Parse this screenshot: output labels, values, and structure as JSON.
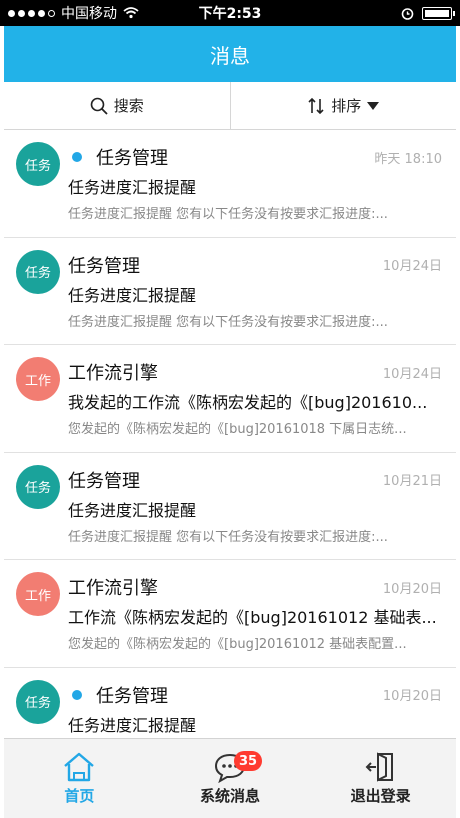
{
  "status_bar": {
    "carrier": "中国移动",
    "time": "下午2:53"
  },
  "header": {
    "title": "消息"
  },
  "toolbar": {
    "search_label": "搜索",
    "sort_label": "排序"
  },
  "colors": {
    "accent": "#22b2e8",
    "task_avatar": "#1aa39b",
    "workflow_avatar": "#f27d72",
    "badge": "#ff3b30"
  },
  "messages": [
    {
      "avatar": "任务",
      "title": "任务管理",
      "unread": true,
      "time": "昨天 18:10",
      "subject": "任务进度汇报提醒",
      "preview": "任务进度汇报提醒 您有以下任务没有按要求汇报进度:..."
    },
    {
      "avatar": "任务",
      "title": "任务管理",
      "unread": false,
      "time": "10月24日",
      "subject": "任务进度汇报提醒",
      "preview": "任务进度汇报提醒 您有以下任务没有按要求汇报进度:..."
    },
    {
      "avatar": "工作",
      "title": "工作流引擎",
      "unread": false,
      "time": "10月24日",
      "subject": "我发起的工作流《陈柄宏发起的《[bug]201610...",
      "preview": "您发起的《陈柄宏发起的《[bug]20161018 下属日志统..."
    },
    {
      "avatar": "任务",
      "title": "任务管理",
      "unread": false,
      "time": "10月21日",
      "subject": "任务进度汇报提醒",
      "preview": "任务进度汇报提醒 您有以下任务没有按要求汇报进度:..."
    },
    {
      "avatar": "工作",
      "title": "工作流引擎",
      "unread": false,
      "time": "10月20日",
      "subject": "工作流《陈柄宏发起的《[bug]20161012 基础表...",
      "preview": "您发起的《陈柄宏发起的《[bug]20161012 基础表配置..."
    },
    {
      "avatar": "任务",
      "title": "任务管理",
      "unread": true,
      "time": "10月20日",
      "subject": "任务进度汇报提醒",
      "preview": ""
    }
  ],
  "tabbar": {
    "home": "首页",
    "messages": "系统消息",
    "messages_badge": "35",
    "logout": "退出登录"
  }
}
